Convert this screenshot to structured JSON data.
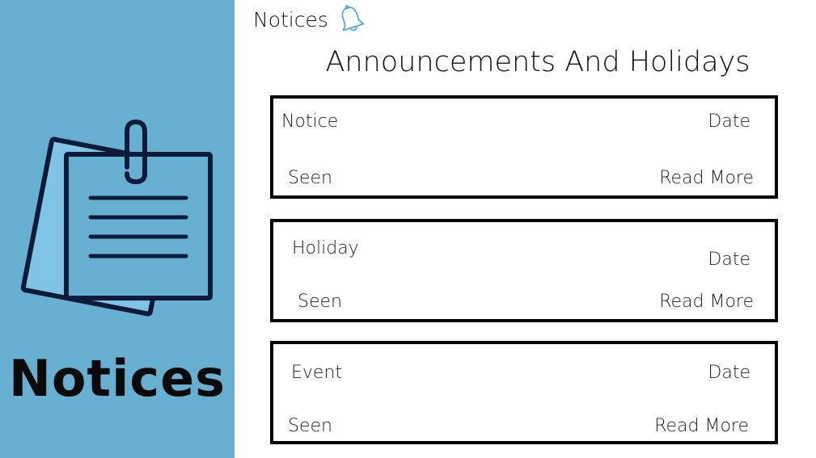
{
  "sidebar": {
    "title": "Notices"
  },
  "topbar": {
    "title": "Notices",
    "icon": "bell-icon"
  },
  "main": {
    "heading": "Announcements And Holidays",
    "cards": [
      {
        "type_label": "Notice",
        "date_label": "Date",
        "seen_label": "Seen",
        "read_more_label": "Read More"
      },
      {
        "type_label": "Holiday",
        "date_label": "Date",
        "seen_label": "Seen",
        "read_more_label": "Read More"
      },
      {
        "type_label": "Event",
        "date_label": "Date",
        "seen_label": "Seen",
        "read_more_label": "Read More"
      }
    ]
  },
  "colors": {
    "sidebar_bg": "#68b0d2",
    "note_fill": "#7fc4e4",
    "note_stroke": "#0d1b3a",
    "bell_stroke": "#3aa0e0"
  }
}
